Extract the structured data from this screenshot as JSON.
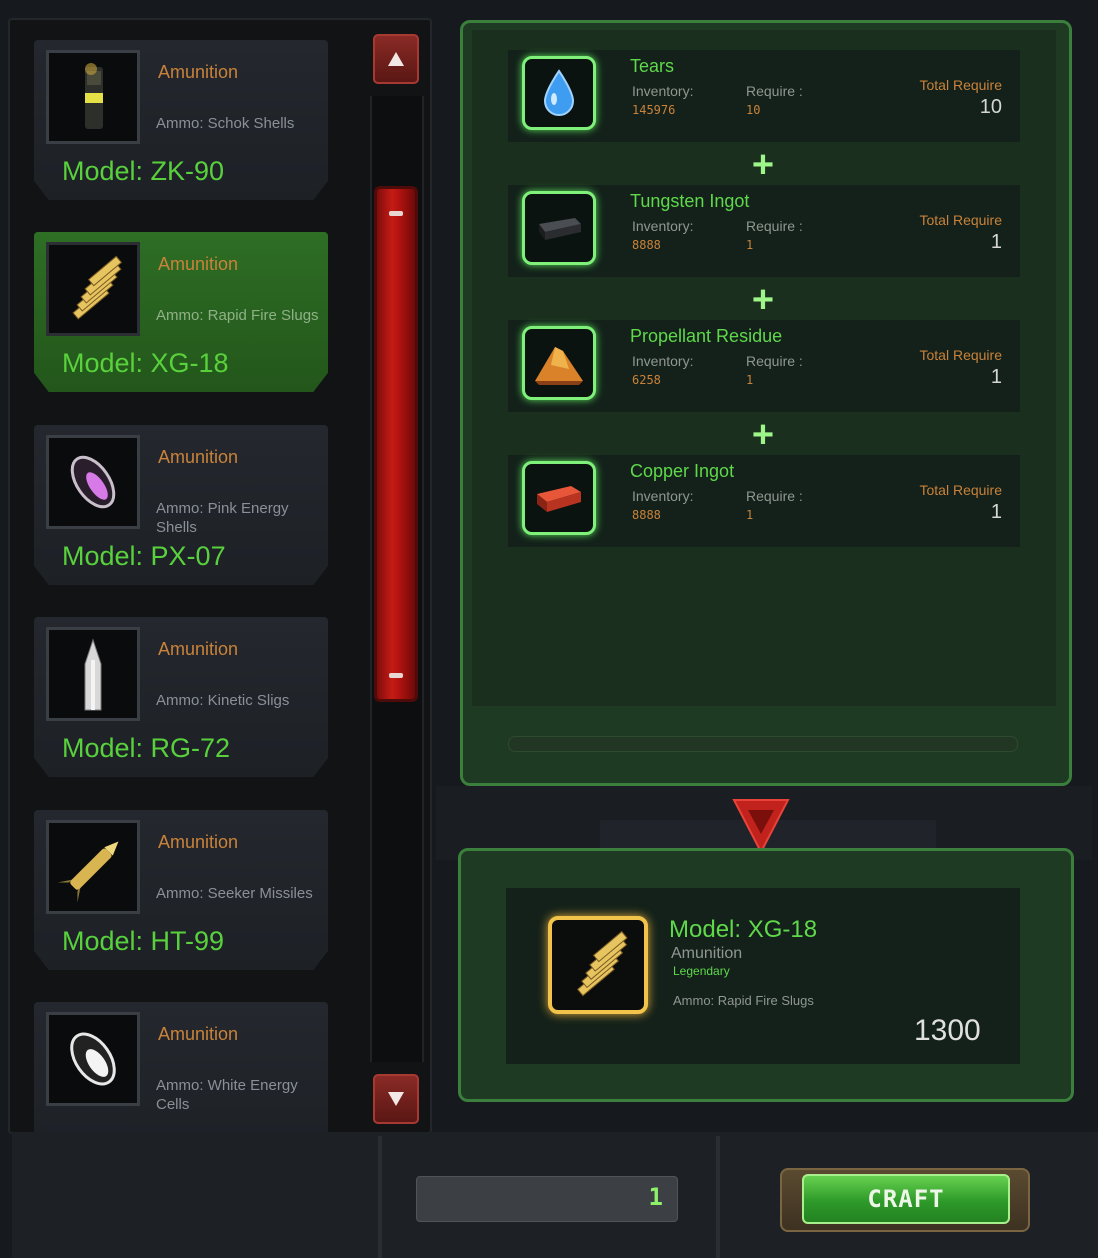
{
  "list": {
    "items": [
      {
        "category": "Amunition",
        "desc": "Ammo: Schok Shells",
        "model": "Model: ZK-90",
        "icon": "shell-icon",
        "selected": false
      },
      {
        "category": "Amunition",
        "desc": "Ammo: Rapid Fire Slugs",
        "model": "Model: XG-18",
        "icon": "slugs-icon",
        "selected": true
      },
      {
        "category": "Amunition",
        "desc": "Ammo: Pink Energy Shells",
        "model": "Model: PX-07",
        "icon": "pink-energy-icon",
        "selected": false
      },
      {
        "category": "Amunition",
        "desc": "Ammo: Kinetic Sligs",
        "model": "Model: RG-72",
        "icon": "kinetic-bullet-icon",
        "selected": false
      },
      {
        "category": "Amunition",
        "desc": "Ammo: Seeker Missiles",
        "model": "Model: HT-99",
        "icon": "missile-icon",
        "selected": false
      },
      {
        "category": "Amunition",
        "desc": "Ammo: White Energy Cells",
        "model": "",
        "icon": "white-energy-icon",
        "selected": false
      }
    ]
  },
  "recipe": {
    "inventory_label": "Inventory:",
    "require_label": "Require :",
    "total_label": "Total Require",
    "plus": "+",
    "ingredients": [
      {
        "name": "Tears",
        "inventory": "145976",
        "require": "10",
        "total": "10",
        "icon": "water-drop-icon"
      },
      {
        "name": "Tungsten Ingot",
        "inventory": "8888",
        "require": "1",
        "total": "1",
        "icon": "tungsten-ingot-icon"
      },
      {
        "name": "Propellant Residue",
        "inventory": "6258",
        "require": "1",
        "total": "1",
        "icon": "propellant-pile-icon"
      },
      {
        "name": "Copper Ingot",
        "inventory": "8888",
        "require": "1",
        "total": "1",
        "icon": "copper-ingot-icon"
      }
    ]
  },
  "result": {
    "model": "Model: XG-18",
    "category": "Amunition",
    "rarity": "Legendary",
    "desc": "Ammo: Rapid Fire Slugs",
    "price": "1300",
    "icon": "slugs-icon"
  },
  "footer": {
    "quantity": "1",
    "craft_label": "CRAFT"
  },
  "colors": {
    "accent_green": "#5fd84a",
    "category_orange": "#c9823a",
    "scroll_red": "#c61b15",
    "legendary_gold": "#f2c34a"
  }
}
